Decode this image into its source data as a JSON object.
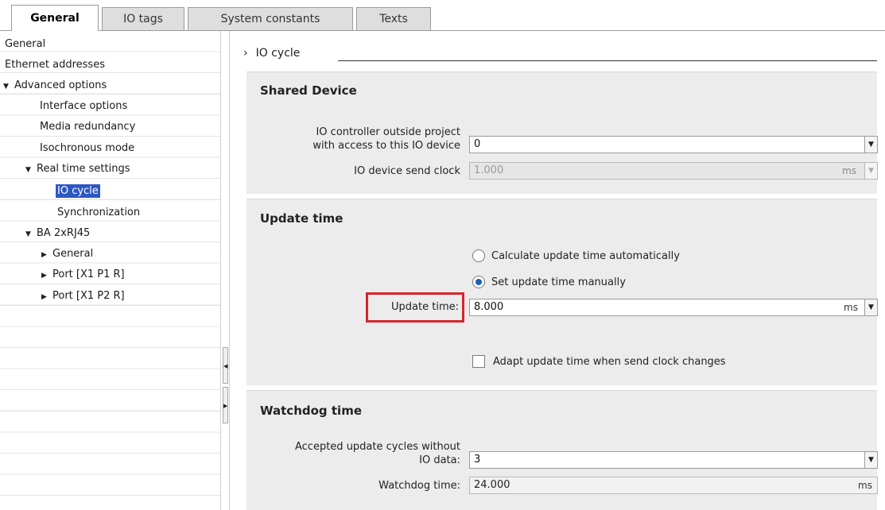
{
  "tabs": [
    {
      "label": "General",
      "active": true
    },
    {
      "label": "IO tags",
      "active": false
    },
    {
      "label": "System constants",
      "active": false
    },
    {
      "label": "Texts",
      "active": false
    }
  ],
  "tree": {
    "items": [
      {
        "label": "General",
        "level": 0,
        "caret": ""
      },
      {
        "label": "Ethernet addresses",
        "level": 0,
        "caret": ""
      },
      {
        "label": "Advanced options",
        "level": 0,
        "caret": "▼"
      },
      {
        "label": "Interface options",
        "level": 1,
        "caret": ""
      },
      {
        "label": "Media redundancy",
        "level": 1,
        "caret": ""
      },
      {
        "label": "Isochronous mode",
        "level": 1,
        "caret": ""
      },
      {
        "label": "Real time settings",
        "level": 1,
        "caret": "▼"
      },
      {
        "label": "IO cycle",
        "level": 2,
        "caret": "",
        "selected": true
      },
      {
        "label": "Synchronization",
        "level": 2,
        "caret": ""
      },
      {
        "label": "BA 2xRJ45",
        "level": 1,
        "caret": "▼"
      },
      {
        "label": "General",
        "level": 2,
        "caret": "▶"
      },
      {
        "label": "Port [X1 P1 R]",
        "level": 2,
        "caret": "▶"
      },
      {
        "label": "Port [X1 P2 R]",
        "level": 2,
        "caret": "▶"
      }
    ]
  },
  "breadcrumb": {
    "arrow": "›",
    "title": "IO cycle"
  },
  "shared_device": {
    "title": "Shared Device",
    "controller_label_line1": "IO controller outside project",
    "controller_label_line2": "with access to this IO device",
    "controller_value": "0",
    "send_clock_label": "IO device send clock",
    "send_clock_value": "1.000",
    "send_clock_unit": "ms"
  },
  "update_time": {
    "title": "Update time",
    "option_auto": "Calculate update time automatically",
    "option_manual": "Set update time manually",
    "selected_option": "manual",
    "field_label": "Update time:",
    "field_value": "8.000",
    "field_unit": "ms",
    "adapt_label": "Adapt update time when send clock changes",
    "adapt_checked": false
  },
  "watchdog": {
    "title": "Watchdog time",
    "cycles_label_line1": "Accepted update cycles without",
    "cycles_label_line2": "IO data:",
    "cycles_value": "3",
    "time_label": "Watchdog time:",
    "time_value": "24.000",
    "time_unit": "ms"
  },
  "icons": {
    "dropdown": "chevron-down-icon",
    "expand": "triangle-down-icon",
    "collapse": "triangle-right-icon"
  },
  "colors": {
    "selection": "#2c58c4",
    "highlight_box": "#d9232d",
    "section_bg": "#ececec"
  }
}
